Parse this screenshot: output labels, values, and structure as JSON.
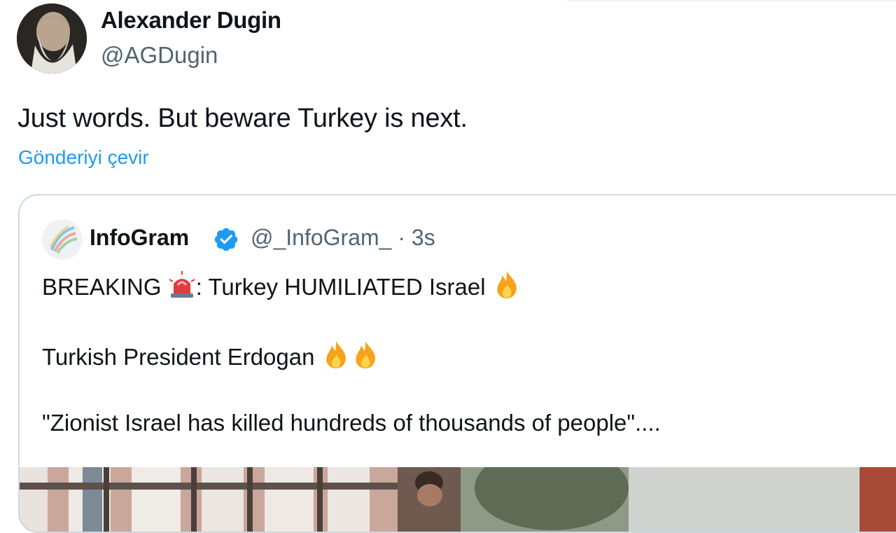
{
  "tweet": {
    "author_name": "Alexander Dugin",
    "author_handle": "@AGDugin",
    "text": "Just words. But beware Turkey is next.",
    "translate_label": "Gönderiyi çevir"
  },
  "quoted": {
    "author_name": "InfoGram",
    "author_meta": "@_InfoGram_ · 3s",
    "line1_prefix": "BREAKING ",
    "line1_suffix": ": Turkey HUMILIATED Israel ",
    "line2": "Turkish President Erdogan ",
    "line3": "\"Zionist Israel has killed hundreds of thousands of people\"....",
    "icons": {
      "verified": "verified-badge-icon",
      "siren": "police-siren-emoji",
      "fire": "fire-emoji"
    }
  },
  "colors": {
    "link": "#1d9bf0",
    "secondary_text": "#536471",
    "border": "#cfd9de",
    "verified": "#1d9bf0"
  }
}
